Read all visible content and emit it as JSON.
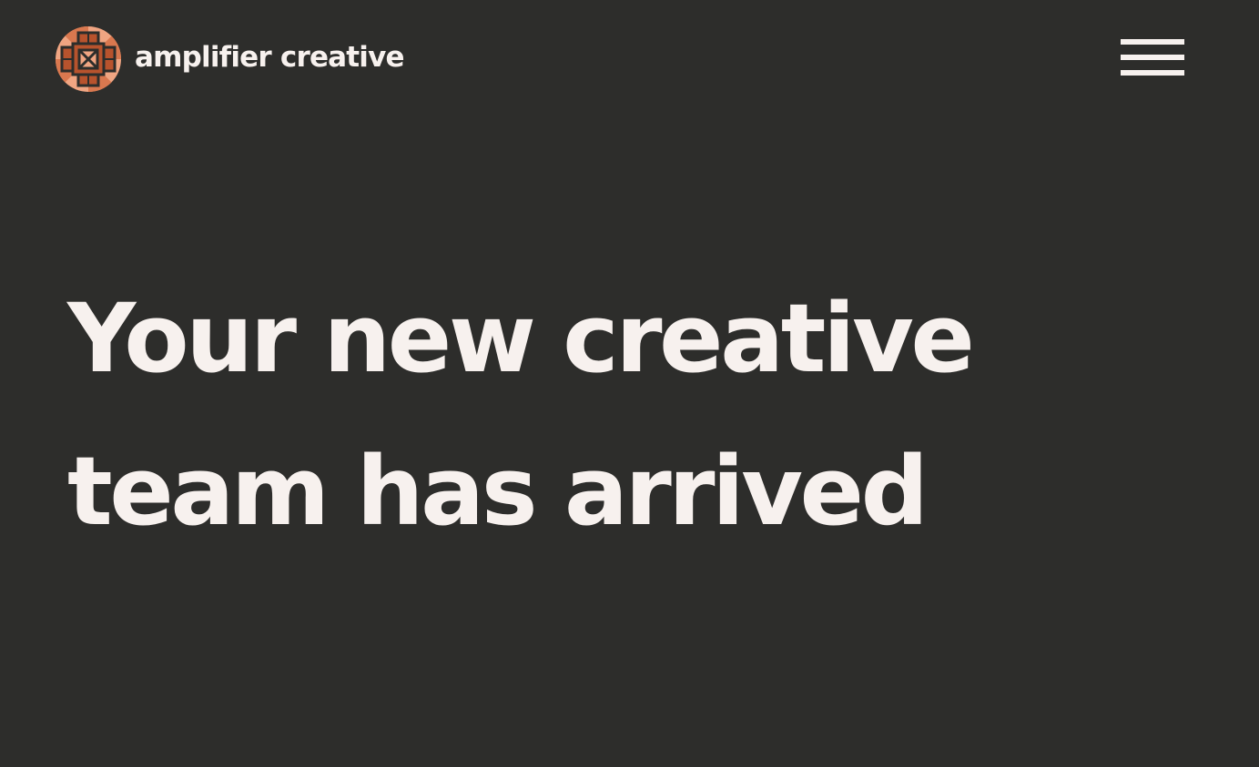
{
  "brand": {
    "name": "amplifier creative",
    "logo_icon": "amplifier-logo-icon",
    "colors": {
      "logo_light": "#f0a582",
      "logo_mid": "#b8532d",
      "logo_dark": "#2d2d2b"
    }
  },
  "nav": {
    "menu_icon": "hamburger-menu-icon"
  },
  "hero": {
    "title_lines": [
      "Your new creative",
      "team has arrived"
    ]
  },
  "theme": {
    "background": "#2d2d2b",
    "text": "#f7f1ee"
  }
}
